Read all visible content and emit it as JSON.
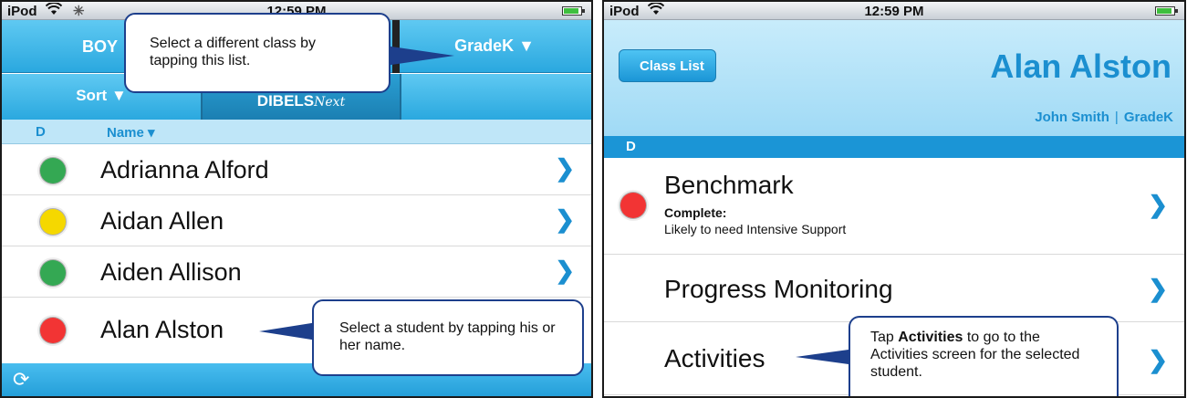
{
  "left": {
    "status": {
      "carrier": "iPod",
      "time": "12:59 PM"
    },
    "topbar": {
      "class_label": "BOY",
      "grade_label": "GradeK ▼"
    },
    "secondbar": {
      "sort_label": "Sort ▼",
      "dibels_main": "DIBELS",
      "dibels_suffix": "Next"
    },
    "list_header": {
      "col_d": "D",
      "col_name": "Name ▾"
    },
    "students": [
      {
        "name": "Adrianna Alford",
        "status": "green"
      },
      {
        "name": "Aidan Allen",
        "status": "yellow"
      },
      {
        "name": "Aiden Allison",
        "status": "green"
      },
      {
        "name": "Alan Alston",
        "status": "red"
      }
    ],
    "callout_class": "Select a different class by tapping this list.",
    "callout_student": "Select a student by tapping his or her name."
  },
  "right": {
    "status": {
      "carrier": "iPod",
      "time": "12:59 PM"
    },
    "back_label": "Class List",
    "student_name": "Alan Alston",
    "teacher": "John Smith",
    "grade": "GradeK",
    "section_header": "D",
    "rows": [
      {
        "title": "Benchmark",
        "sub1": "Complete:",
        "sub2": "Likely to need Intensive Support",
        "status": "red"
      },
      {
        "title": "Progress Monitoring"
      },
      {
        "title": "Activities"
      }
    ],
    "callout_activities_prefix": "Tap ",
    "callout_activities_bold": "Activities",
    "callout_activities_suffix": " to go to the Activities screen for the selected student."
  },
  "colors": {
    "accent_blue": "#1b8fd0",
    "callout_border": "#1d3f8c",
    "status_green": "#34a853",
    "status_yellow": "#f5d800",
    "status_red": "#f23434"
  },
  "icons": [
    "wifi-icon",
    "activity-spinner-icon",
    "battery-icon",
    "chevron-right-icon",
    "sync-icon",
    "back-arrow-icon"
  ]
}
